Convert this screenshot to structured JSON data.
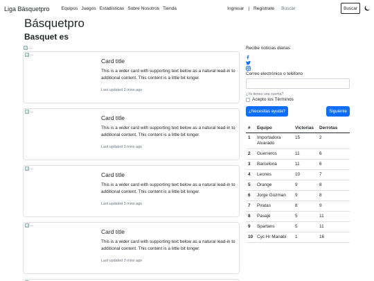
{
  "navbar": {
    "brand": "Liga Básquetpro",
    "links": [
      "Equipos",
      "Juegos",
      "Estadísticas",
      "Sobre Nosotros",
      "Tienda"
    ],
    "login": "Ingresar",
    "separator": "|",
    "register": "Registrate",
    "search_placeholder": "Buscar",
    "search_button": "Buscar",
    "theme_icon": "moon-icon"
  },
  "header": {
    "title": "Básquetpro",
    "subtitle": "Basquet es"
  },
  "top_image_alt": "...",
  "cards": [
    {
      "img_alt": "...",
      "title": "Card title",
      "text": "This is a wider card with supporting text below as a natural lead-in to additional content. This content is a little bit longer.",
      "updated": "Last updated 3 mins ago"
    },
    {
      "img_alt": "...",
      "title": "Card title",
      "text": "This is a wider card with supporting text below as a natural lead-in to additional content. This content is a little bit longer.",
      "updated": "Last updated 3 mins ago"
    },
    {
      "img_alt": "...",
      "title": "Card title",
      "text": "This is a wider card with supporting text below as a natural lead-in to additional content. This content is a little bit longer.",
      "updated": "Last updated 3 mins ago"
    },
    {
      "img_alt": "...",
      "title": "Card title",
      "text": "This is a wider card with supporting text below as a natural lead-in to additional content. This content is a little bit longer.",
      "updated": "Last updated 3 mins ago"
    }
  ],
  "sidebar": {
    "newsletter_label": "Recibe noticias diarias",
    "social_icons": [
      "facebook-icon",
      "twitter-icon",
      "instagram-icon"
    ],
    "email_label": "Correo electrónico o teléfono",
    "account_question": "¿Ya tienes una cuenta?",
    "terms_label": "Acepto los Términos",
    "help_button": "¿Necesitas ayuda?",
    "next_button": "Siguiente",
    "accent_color": "#0d6efd"
  },
  "standings": {
    "headers": [
      "#",
      "Equipo",
      "Victorias",
      "Derrotas"
    ],
    "rows": [
      {
        "pos": "1",
        "team": "Importadora Alvarado",
        "wins": "15",
        "losses": "2"
      },
      {
        "pos": "2",
        "team": "Guerreros",
        "wins": "11",
        "losses": "6"
      },
      {
        "pos": "3",
        "team": "Barcelona",
        "wins": "11",
        "losses": "6"
      },
      {
        "pos": "4",
        "team": "Leones",
        "wins": "10",
        "losses": "7"
      },
      {
        "pos": "5",
        "team": "Orange",
        "wins": "9",
        "losses": "8"
      },
      {
        "pos": "6",
        "team": "Jorge Gúzman",
        "wins": "9",
        "losses": "8"
      },
      {
        "pos": "7",
        "team": "Piratas",
        "wins": "8",
        "losses": "9"
      },
      {
        "pos": "8",
        "team": "Pasaje",
        "wins": "5",
        "losses": "11"
      },
      {
        "pos": "9",
        "team": "Spartans",
        "wins": "5",
        "losses": "11"
      },
      {
        "pos": "10",
        "team": "Cyc Hr Manabí",
        "wins": "1",
        "losses": "16"
      }
    ]
  }
}
